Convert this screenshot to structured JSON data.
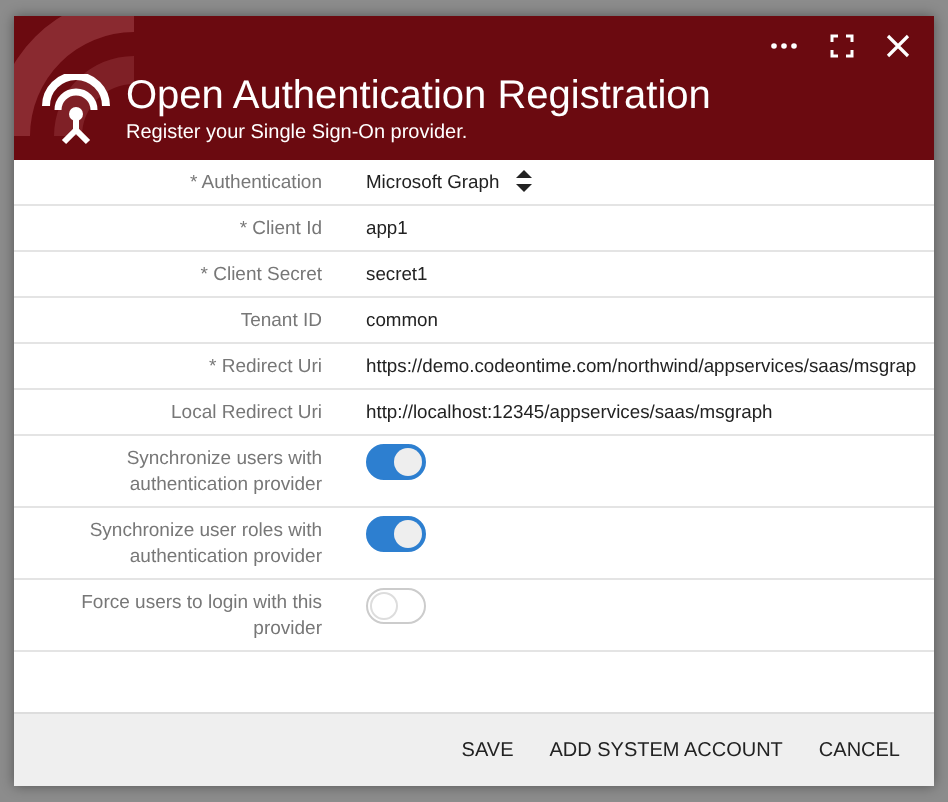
{
  "dialog": {
    "title": "Open Authentication Registration",
    "subtitle": "Register your Single Sign-On provider.",
    "fields": [
      {
        "kind": "select",
        "label": "* Authentication",
        "value": "Microsoft Graph"
      },
      {
        "kind": "text",
        "label": "* Client Id",
        "value": "app1"
      },
      {
        "kind": "text",
        "label": "* Client Secret",
        "value": "secret1"
      },
      {
        "kind": "text",
        "label": "Tenant ID",
        "value": "common"
      },
      {
        "kind": "text",
        "label": "* Redirect Uri",
        "value": "https://demo.codeontime.com/northwind/appservices/saas/msgrap"
      },
      {
        "kind": "text",
        "label": "Local Redirect Uri",
        "value": "http://localhost:12345/appservices/saas/msgraph"
      },
      {
        "kind": "toggle",
        "label": "Synchronize users with authentication provider",
        "on": true
      },
      {
        "kind": "toggle",
        "label": "Synchronize user roles with authentication provider",
        "on": true
      },
      {
        "kind": "toggle",
        "label": "Force users to login with this provider",
        "on": false
      }
    ],
    "buttons": [
      "SAVE",
      "ADD SYSTEM ACCOUNT",
      "CANCEL"
    ]
  }
}
